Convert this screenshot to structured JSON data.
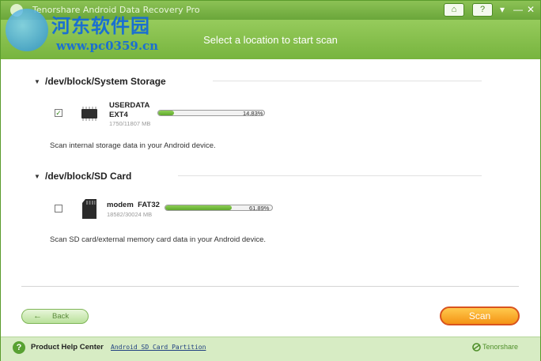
{
  "window": {
    "title": "Tenorshare Android Data Recovery Pro",
    "home_glyph": "⌂",
    "help_glyph": "?",
    "menu_glyph": "▾",
    "minimize_glyph": "—",
    "close_glyph": "✕"
  },
  "header": {
    "title": "Select a location to start scan"
  },
  "watermark": {
    "title": "河东软件园",
    "url": "www.pc0359.cn"
  },
  "sections": [
    {
      "title": "/dev/block/System Storage",
      "partition": {
        "name": "USERDATA",
        "fs": "EXT4",
        "size": "1750/11807 MB",
        "usage_percent": 14.83,
        "usage_label": "14.83%",
        "checked": true,
        "check_glyph": "✓",
        "icon": "chip-icon"
      },
      "description": "Scan internal storage data in your Android device."
    },
    {
      "title": "/dev/block/SD Card",
      "partition": {
        "name": "modem",
        "fs": "FAT32",
        "size": "18582/30024 MB",
        "usage_percent": 61.89,
        "usage_label": "61.89%",
        "checked": false,
        "check_glyph": "",
        "icon": "sd-card-icon"
      },
      "description": "Scan SD card/external memory card data in your Android device."
    }
  ],
  "buttons": {
    "back": "Back",
    "back_arrow": "←",
    "scan": "Scan"
  },
  "footer": {
    "help_glyph": "?",
    "help_label": "Product Help Center",
    "link": "Android SD Card Partition",
    "brand": "Tenorshare"
  },
  "colors": {
    "accent": "#6aa63a",
    "scan": "#f49314",
    "link": "#1f3f80"
  }
}
